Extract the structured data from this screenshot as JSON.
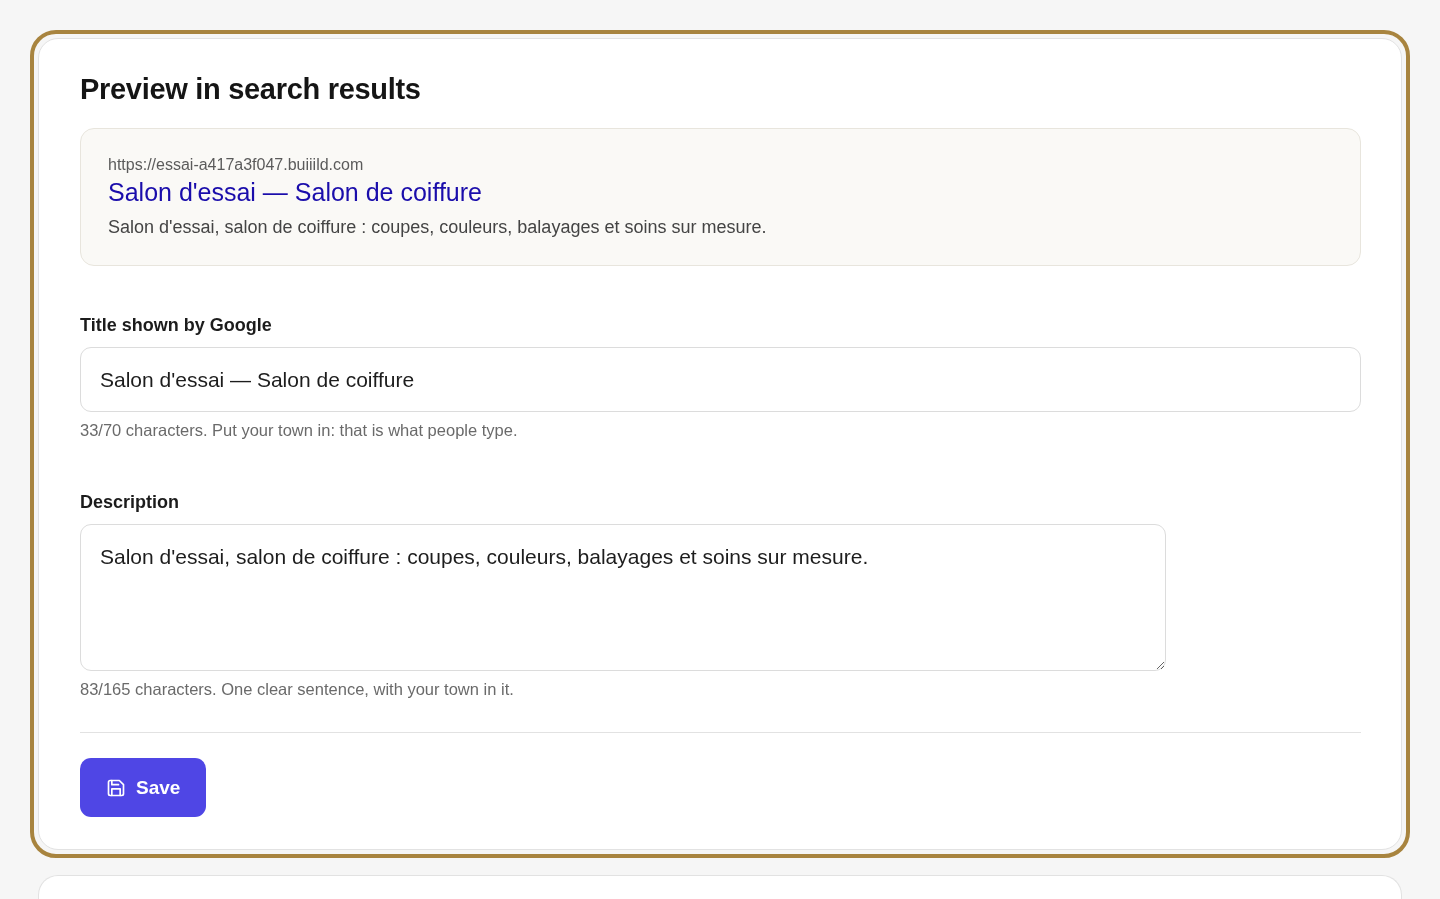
{
  "heading": "Preview in search results",
  "preview": {
    "url": "https://essai-a417a3f047.buiiild.com",
    "title": "Salon d'essai — Salon de coiffure",
    "description": "Salon d'essai, salon de coiffure : coupes, couleurs, balayages et soins sur mesure."
  },
  "fields": [
    {
      "kind": "input",
      "label": "Title shown by Google",
      "value": "Salon d'essai — Salon de coiffure",
      "hint": "33/70 characters. Put your town in: that is what people type."
    },
    {
      "kind": "textarea",
      "label": "Description",
      "value": "Salon d'essai, salon de coiffure : coupes, couleurs, balayages et soins sur mesure.",
      "hint": "83/165 characters. One clear sentence, with your town in it."
    }
  ],
  "save_button": {
    "label": "Save"
  }
}
